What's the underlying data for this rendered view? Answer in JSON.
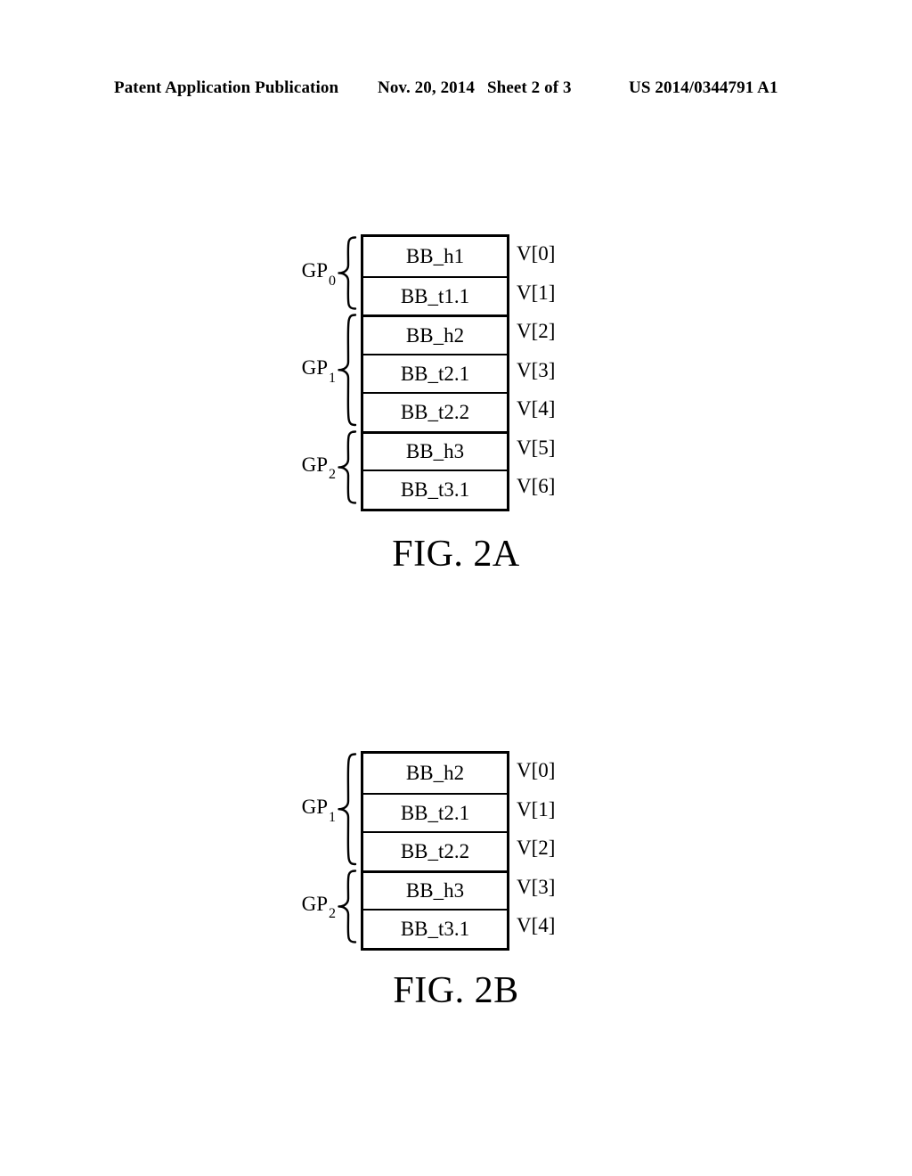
{
  "header": {
    "publication": "Patent Application Publication",
    "date": "Nov. 20, 2014",
    "sheet": "Sheet 2 of 3",
    "patent_number": "US 2014/0344791 A1"
  },
  "figures": [
    {
      "id": "fig-2a",
      "caption": "FIG. 2A",
      "rows": [
        {
          "block": "BB_h1",
          "vector": "V[0]"
        },
        {
          "block": "BB_t1.1",
          "vector": "V[1]"
        },
        {
          "block": "BB_h2",
          "vector": "V[2]"
        },
        {
          "block": "BB_t2.1",
          "vector": "V[3]"
        },
        {
          "block": "BB_t2.2",
          "vector": "V[4]"
        },
        {
          "block": "BB_h3",
          "vector": "V[5]"
        },
        {
          "block": "BB_t3.1",
          "vector": "V[6]"
        }
      ],
      "groups": [
        {
          "name": "GP",
          "subscript": "0",
          "start": 0,
          "count": 2
        },
        {
          "name": "GP",
          "subscript": "1",
          "start": 2,
          "count": 3
        },
        {
          "name": "GP",
          "subscript": "2",
          "start": 5,
          "count": 2
        }
      ]
    },
    {
      "id": "fig-2b",
      "caption": "FIG. 2B",
      "rows": [
        {
          "block": "BB_h2",
          "vector": "V[0]"
        },
        {
          "block": "BB_t2.1",
          "vector": "V[1]"
        },
        {
          "block": "BB_t2.2",
          "vector": "V[2]"
        },
        {
          "block": "BB_h3",
          "vector": "V[3]"
        },
        {
          "block": "BB_t3.1",
          "vector": "V[4]"
        }
      ],
      "groups": [
        {
          "name": "GP",
          "subscript": "1",
          "start": 0,
          "count": 3
        },
        {
          "name": "GP",
          "subscript": "2",
          "start": 3,
          "count": 2
        }
      ]
    }
  ],
  "style": {
    "ink": "#000000",
    "paper": "#ffffff",
    "row_height": 43.5
  }
}
